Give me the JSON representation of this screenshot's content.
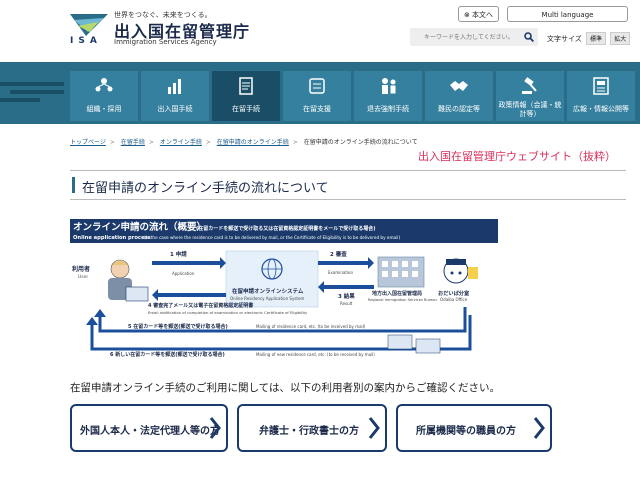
{
  "header": {
    "logo_text": "ISA",
    "tagline": "世界をつなぐ、未来をつくる。",
    "agency_ja": "出入国在留管理庁",
    "agency_en": "Immigration Services Agency",
    "japanese_button": "本文へ",
    "multilanguage_button": "Multi language",
    "search_placeholder": "キーワードを入力してください。",
    "font_size_label": "文字サイズ",
    "font_standard": "標準",
    "font_large": "拡大"
  },
  "nav": {
    "items": [
      {
        "label": "組織・採用",
        "icon": "organization-icon"
      },
      {
        "label": "出入国手続",
        "icon": "chart-icon"
      },
      {
        "label": "在留手続",
        "icon": "document-icon",
        "active": true
      },
      {
        "label": "在留支援",
        "icon": "support-icon"
      },
      {
        "label": "退去強制手続",
        "icon": "deportation-icon"
      },
      {
        "label": "難民の認定等",
        "icon": "handshake-icon"
      },
      {
        "label": "政策情報（会議・統計等）",
        "icon": "gavel-icon"
      },
      {
        "label": "広報・情報公開等",
        "icon": "publication-icon"
      }
    ]
  },
  "breadcrumb": {
    "items": [
      "トップページ",
      "在留手続",
      "オンライン手続",
      "在留申請のオンライン手続",
      "在留申請のオンライン手続の流れについて"
    ]
  },
  "site_note": "出入国在留管理庁ウェブサイト（抜粋）",
  "page_title": "在留申請のオンライン手続の流れについて",
  "diagram": {
    "title": "オンライン申請の流れ（概要）",
    "title_note": "(在留カードを郵送で受け取る又は在留資格認定証明書をメールで受け取る場合)",
    "subtitle": "Online application process",
    "subtitle_note": "(in the case where the residence card is to be delivered by mail, or the Certificate of Eligibility is to be delivered by email)",
    "user_ja": "利用者",
    "user_en": "User",
    "system_ja": "在留申請オンラインシステム",
    "system_en": "Online Residency Application System",
    "bureau_ja": "地方出入国在留管理局",
    "bureau_en": "Regional Immigration Services Bureau",
    "mascot_ja": "おだいば分室",
    "mascot_en": "Odaiba Office",
    "step1_ja": "1 申請",
    "step1_en": "Application",
    "step2_ja": "2 審査",
    "step2_en": "Examination",
    "step3_ja": "3 結果",
    "step3_en": "Result",
    "step4_ja": "4 審査完了メール又は電子在留資格認定証明書",
    "step4_en": "Email notification of completion of examination or electronic Certificate of Eligibility",
    "step5_ja": "5 在留カード等を郵送(郵送で受け取る場合)",
    "step5_en": "Mailing of residence card, etc. (to be received by mail)",
    "step6_ja": "6 新しい在留カード等を郵送(郵送で受け取る場合)",
    "step6_en": "Mailing of new residence card, etc. (to be received by mail)",
    "colors": {
      "header_bg": "#1b3a6b",
      "arrow": "#1b4f9c",
      "panel": "#e6f0fb"
    }
  },
  "intro_text": "在留申請オンライン手続のご利用に関しては、以下の利用者別の案内からご確認ください。",
  "cta_buttons": [
    {
      "label": "外国人本人・法定代理人等の方"
    },
    {
      "label": "弁護士・行政書士の方"
    },
    {
      "label": "所属機関等の職員の方"
    }
  ],
  "colors": {
    "nav_bg": "#2a6d89",
    "nav_item": "#36809f",
    "nav_active": "#1a4e66",
    "accent_red": "#d8305a",
    "navy": "#1b3a6b"
  }
}
